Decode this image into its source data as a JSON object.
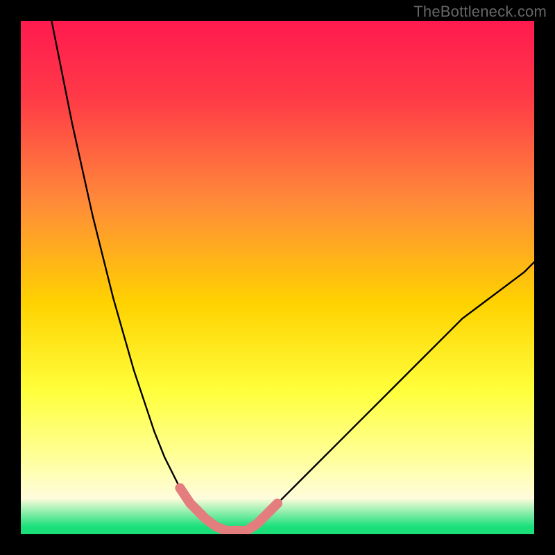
{
  "watermark": "TheBottleneck.com",
  "colors": {
    "frame_bg": "#000000",
    "grad_top": "#ff1a4f",
    "grad_mid_upper": "#ff7a3a",
    "grad_mid": "#ffd200",
    "grad_lower": "#ffff66",
    "grad_pale": "#fffcdc",
    "grad_green": "#1be07a",
    "curve_stroke": "#000000",
    "highlight_stroke": "#e47e7e"
  },
  "chart_data": {
    "type": "line",
    "title": "",
    "xlabel": "",
    "ylabel": "",
    "xlim": [
      0,
      100
    ],
    "ylim": [
      0,
      100
    ],
    "series": [
      {
        "name": "left-curve",
        "x": [
          6,
          8,
          10,
          12,
          14,
          16,
          18,
          20,
          22,
          24,
          26,
          28,
          30,
          31,
          32,
          33,
          34,
          36,
          38,
          40
        ],
        "values": [
          100,
          90,
          80,
          71,
          62,
          54,
          46,
          39,
          32,
          26,
          20,
          15,
          11,
          9,
          7.5,
          6,
          5,
          3,
          1.5,
          0.7
        ]
      },
      {
        "name": "valley-flat",
        "x": [
          40,
          42,
          44
        ],
        "values": [
          0.7,
          0.7,
          0.7
        ]
      },
      {
        "name": "right-curve",
        "x": [
          44,
          46,
          48,
          50,
          52,
          54,
          58,
          62,
          66,
          70,
          74,
          78,
          82,
          86,
          90,
          94,
          98,
          100
        ],
        "values": [
          0.7,
          2,
          4,
          6,
          8,
          10,
          14,
          18,
          22,
          26,
          30,
          34,
          38,
          42,
          45,
          48,
          51,
          53
        ]
      }
    ],
    "highlight_segments": [
      {
        "name": "left-highlight",
        "x": [
          31,
          32,
          33,
          34,
          36,
          38,
          40
        ],
        "values": [
          9,
          7.5,
          6,
          5,
          3,
          1.5,
          0.7
        ]
      },
      {
        "name": "valley-highlight",
        "x": [
          40,
          42,
          44
        ],
        "values": [
          0.7,
          0.7,
          0.7
        ]
      },
      {
        "name": "right-highlight",
        "x": [
          44,
          46,
          48,
          50
        ],
        "values": [
          0.7,
          2,
          4,
          6
        ]
      }
    ],
    "gradient_stops": [
      {
        "offset": 0.0,
        "color": "#ff1a4f"
      },
      {
        "offset": 0.15,
        "color": "#ff3a47"
      },
      {
        "offset": 0.35,
        "color": "#ff8a3a"
      },
      {
        "offset": 0.55,
        "color": "#ffd200"
      },
      {
        "offset": 0.72,
        "color": "#ffff3b"
      },
      {
        "offset": 0.85,
        "color": "#ffff99"
      },
      {
        "offset": 0.93,
        "color": "#fffcdc"
      },
      {
        "offset": 0.985,
        "color": "#1be07a"
      },
      {
        "offset": 1.0,
        "color": "#1be07a"
      }
    ]
  }
}
